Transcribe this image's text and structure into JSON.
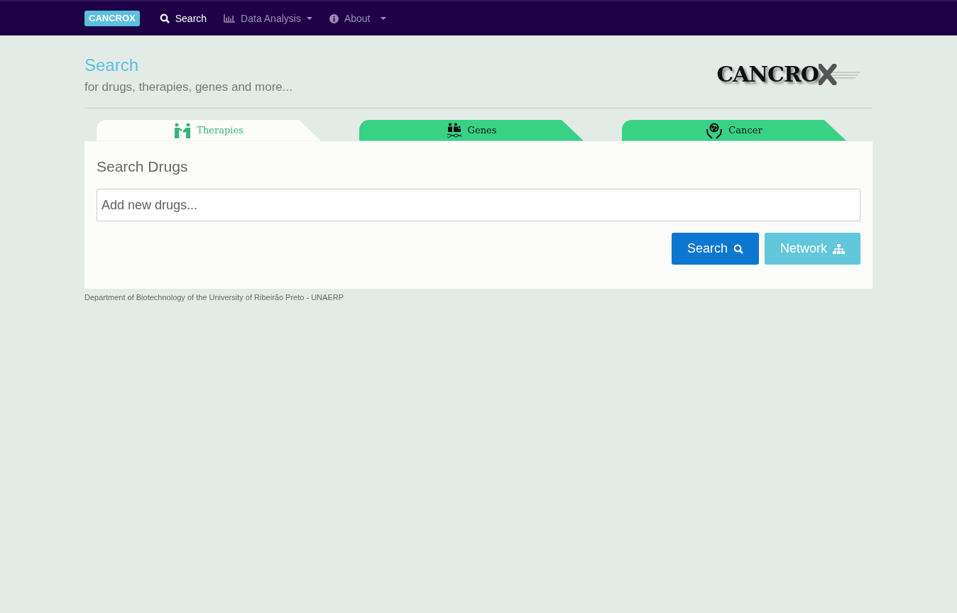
{
  "navbar": {
    "brand": "CANCROX",
    "items": [
      {
        "kind": "link",
        "label": "Search",
        "selected": true
      },
      {
        "kind": "dropdown",
        "label": "Data Analysis",
        "selected": false
      },
      {
        "kind": "dropdown",
        "label": "About",
        "selected": false
      }
    ]
  },
  "header": {
    "title": "Search",
    "subtitle": "for drugs, therapies, genes and more...",
    "logo_text": "CANCRO"
  },
  "tabs": [
    {
      "label": "Therapies",
      "selected": true
    },
    {
      "label": "Genes",
      "selected": false
    },
    {
      "label": "Cancer",
      "selected": false
    }
  ],
  "panel": {
    "title": "Search Drugs",
    "search": {
      "placeholder": "Add new drugs..."
    },
    "buttons": [
      {
        "label": "Search",
        "kind": "primary"
      },
      {
        "label": "Network",
        "kind": "info"
      }
    ]
  },
  "footer": "Department of Biotechnology of the University of Ribeirão Preto - UNAERP"
}
